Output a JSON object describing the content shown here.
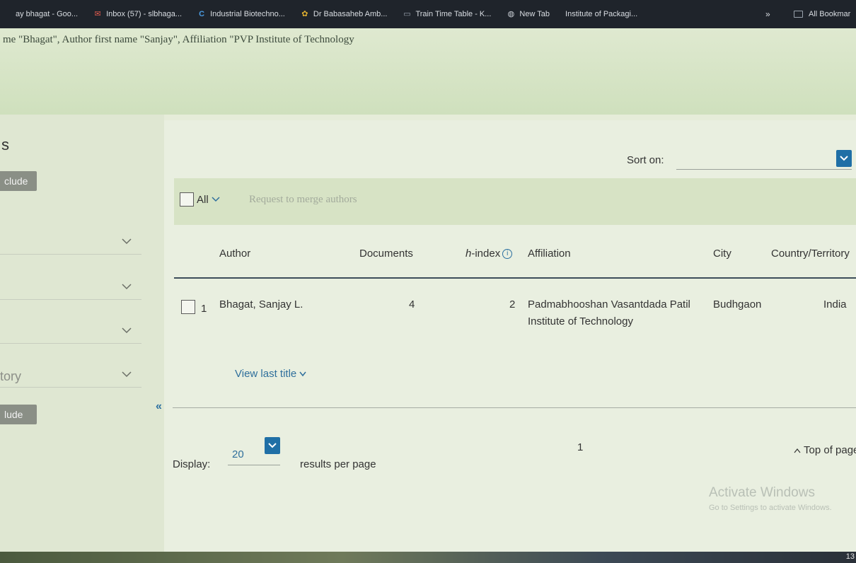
{
  "bookmarks": {
    "items": [
      {
        "label": "ay bhagat - Goo...",
        "icon": "google-icon"
      },
      {
        "label": "Inbox (57) - slbhaga...",
        "icon": "gmail-icon"
      },
      {
        "label": "Industrial Biotechno...",
        "icon": "c-logo-icon"
      },
      {
        "label": "Dr Babasaheb Amb...",
        "icon": "university-icon"
      },
      {
        "label": "Train Time Table - K...",
        "icon": "page-icon"
      },
      {
        "label": "New Tab",
        "icon": "globe-icon"
      },
      {
        "label": "Institute of Packagi...",
        "icon": ""
      }
    ],
    "overflow": "»",
    "all_bookmarks": "All Bookmar"
  },
  "query": {
    "text": "me \"Bhagat\", Author first name \"Sanjay\", Affiliation \"PVP Institute of Technology"
  },
  "filters": {
    "title": "s",
    "include_top": "clude",
    "rows": [
      {
        "label": ""
      },
      {
        "label": ""
      },
      {
        "label": ""
      },
      {
        "label": "tory"
      }
    ],
    "include_bottom": "lude"
  },
  "results": {
    "sort_label": "Sort on:",
    "toolbar": {
      "all_label": "All",
      "merge_label": "Request to merge authors"
    },
    "columns": {
      "author": "Author",
      "documents": "Documents",
      "hindex_italic": "h",
      "hindex_rest": "-index",
      "affiliation": "Affiliation",
      "city": "City",
      "country": "Country/Territory"
    },
    "rows": [
      {
        "index": "1",
        "author": "Bhagat, Sanjay L.",
        "documents": "4",
        "hindex": "2",
        "affiliation_line1": "Padmabhooshan Vasantdada Patil",
        "affiliation_line2": "Institute of Technology",
        "city": "Budhgaon",
        "country": "India",
        "view_last": "View last title"
      }
    ],
    "display_label": "Display:",
    "display_value": "20",
    "per_page": "results per page",
    "page": "1",
    "top_of_page": "Top of page"
  },
  "watermark": {
    "line1": "Activate Windows",
    "line2": "Go to Settings to activate Windows."
  },
  "taskbar": {
    "clock": "13"
  },
  "colors": {
    "accent": "#1f6fa6",
    "link": "#2f6f9c",
    "bookmarks_bar": "#1f242b"
  }
}
